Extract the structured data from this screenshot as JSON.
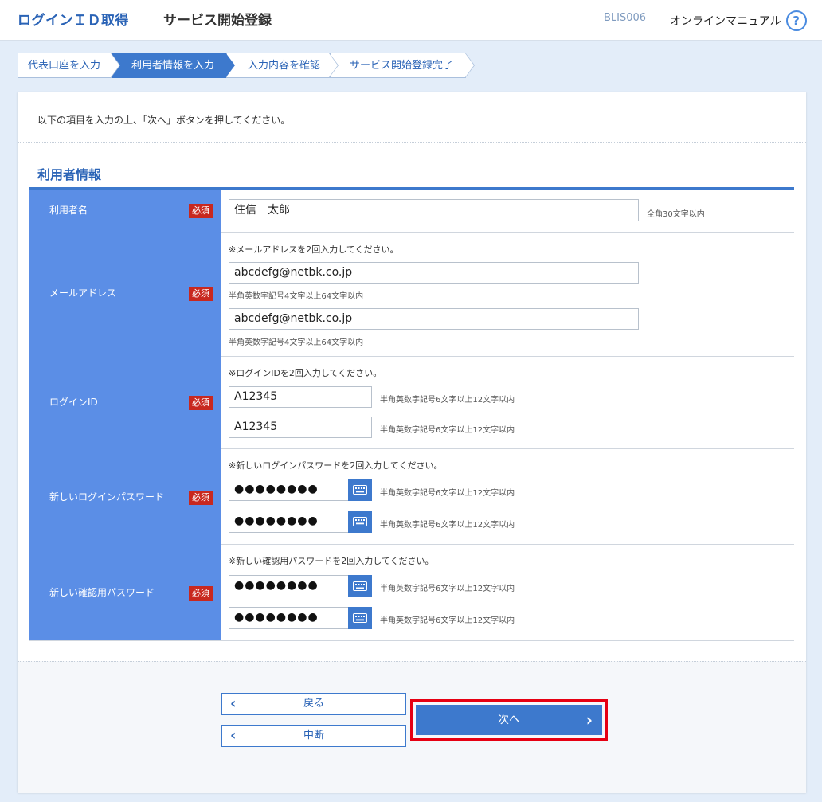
{
  "header": {
    "app_title": "ログインＩＤ取得",
    "page_title": "サービス開始登録",
    "screen_id": "BLIS006",
    "manual_link": "オンラインマニュアル",
    "help_glyph": "?"
  },
  "steps": [
    {
      "label": "代表口座を入力",
      "active": false
    },
    {
      "label": "利用者情報を入力",
      "active": true
    },
    {
      "label": "入力内容を確認",
      "active": false
    },
    {
      "label": "サービス開始登録完了",
      "active": false
    }
  ],
  "instruction": "以下の項目を入力の上、「次へ」ボタンを押してください。",
  "section_title": "利用者情報",
  "required_label": "必須",
  "form": {
    "user_name": {
      "label": "利用者名",
      "value": "住信　太郎",
      "hint": "全角30文字以内"
    },
    "email": {
      "label": "メールアドレス",
      "note": "※メールアドレスを2回入力してください。",
      "value1": "abcdefg@netbk.co.jp",
      "value2": "abcdefg@netbk.co.jp",
      "hint": "半角英数字記号4文字以上64文字以内"
    },
    "login_id": {
      "label": "ログインID",
      "note": "※ログインIDを2回入力してください。",
      "value1": "A12345",
      "value2": "A12345",
      "hint": "半角英数字記号6文字以上12文字以内"
    },
    "login_password": {
      "label": "新しいログインパスワード",
      "note": "※新しいログインパスワードを2回入力してください。",
      "masked": "●●●●●●●●",
      "hint": "半角英数字記号6文字以上12文字以内"
    },
    "confirm_password": {
      "label": "新しい確認用パスワード",
      "note": "※新しい確認用パスワードを2回入力してください。",
      "masked": "●●●●●●●●",
      "hint": "半角英数字記号6文字以上12文字以内"
    }
  },
  "buttons": {
    "back": "戻る",
    "suspend": "中断",
    "next": "次へ"
  },
  "icons": {
    "keyboard": "software-keyboard-icon",
    "help": "help-icon"
  },
  "colors": {
    "brand_blue": "#3d79cd",
    "label_bg": "#5b8ee6",
    "required_red": "#c8281f",
    "highlight_red": "#e60012"
  }
}
